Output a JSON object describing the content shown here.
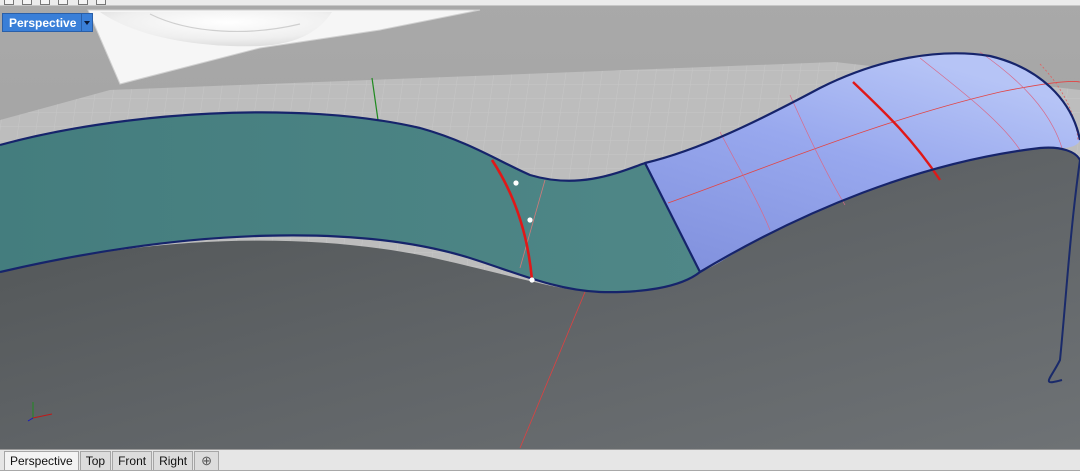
{
  "viewport": {
    "title": "Perspective"
  },
  "tabs": [
    {
      "label": "Perspective",
      "active": true
    },
    {
      "label": "Top",
      "active": false
    },
    {
      "label": "Front",
      "active": false
    },
    {
      "label": "Right",
      "active": false
    }
  ],
  "add_tab_icon": "plus-icon",
  "colors": {
    "selection_blue": "#3a7fd8",
    "surface_teal": "#4b8383",
    "surface_gray": "#5d6163",
    "surface_selected": "#8f9fe6",
    "edge_dark": "#1a2a6a",
    "seam_red": "#e01818"
  }
}
